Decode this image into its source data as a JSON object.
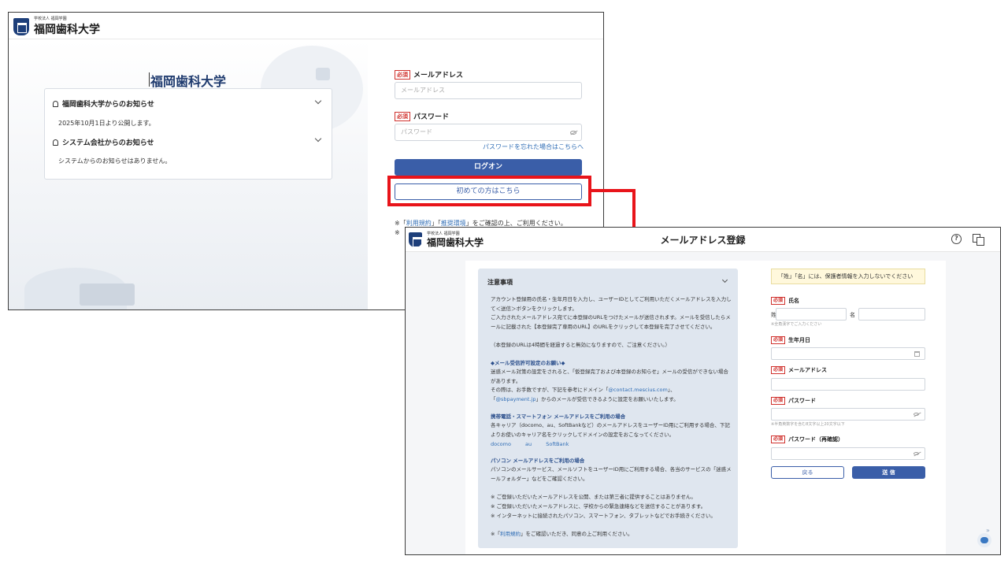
{
  "login": {
    "logo_sub": "学校法人 福岡学園",
    "logo_main": "福岡歯科大学",
    "center_title": "福岡歯科大学",
    "notices": [
      {
        "heading": "福岡歯科大学からのお知らせ",
        "body": "2025年10月1日より公開します。"
      },
      {
        "heading": "システム会社からのお知らせ",
        "body": "システムからのお知らせはありません。"
      }
    ],
    "required_badge": "必須",
    "email_label": "メールアドレス",
    "email_placeholder": "メールアドレス",
    "password_label": "パスワード",
    "password_placeholder": "パスワード",
    "forgot_password": "パスワードを忘れた場合はこちらへ",
    "logon_button": "ログオン",
    "first_time_button": "初めての方はこちら",
    "terms_prefix": "※「",
    "terms_link": "利用規約",
    "terms_mid": "」「",
    "env_link": "推奨環境",
    "terms_suffix": "」をご確認の上、ご利用ください。",
    "terms_note2": "※"
  },
  "register": {
    "logo_sub": "学校法人 福岡学園",
    "logo_main": "福岡歯科大学",
    "title": "メールアドレス登録",
    "help_icon": "?",
    "notice_heading": "注意事項",
    "p1": "アカウント登録用の氏名・生年月日を入力し、ユーザーIDとしてご利用いただくメールアドレスを入力して＜送信＞ボタンをクリックします。",
    "p2": "ご入力されたメールアドレス宛てに本登録のURLをつけたメールが送信されます。メールを受信したらメールに記載された【本登録完了専用のURL】のURLをクリックして本登録を完了させてください。",
    "p3": "（本登録のURLは4時間を経過すると無効になりますので、ご注意ください。）",
    "s1_title": "◆メール受信許可設定のお願い◆",
    "s1_text": "迷惑メール対策の設定をされると、「仮登録完了および本登録のお知らせ」メールの受信ができない場合があります。",
    "s1_text2_a": "その際は、お手数ですが、下記を参考にドメイン「",
    "s1_domain1": "@contact.mescius.com",
    "s1_text2_b": "」、",
    "s1_text3_a": "「",
    "s1_domain2": "@sbpayment.jp",
    "s1_text3_b": "」からのメールが受信できるように設定をお願いいたします。",
    "s2_title": "携帯電話・スマートフォン メールアドレスをご利用の場合",
    "s2_text": "各キャリア（docomo、au、SoftBankなど）のメールアドレスをユーザーID用にご利用する場合、下記よりお使いのキャリア名をクリックしてドメインの設定をおこなってください。",
    "carriers": [
      "docomo",
      "au",
      "SoftBank"
    ],
    "s3_title": "パソコン メールアドレスをご利用の場合",
    "s3_text": "パソコンのメールサービス、メールソフトをユーザーID用にご利用する場合、各当のサービスの「迷惑メールフォルダー」などをご確認ください。",
    "f1": "※ ご登録いただいたメールアドレスを公開、または第三者に提供することはありません。",
    "f2": "※ ご登録いただいたメールアドレスに、学校からの緊急連絡などを送信することがあります。",
    "f3": "※ インターネットに接続されたパソコン、スマートフォン、タブレットなどでお手続きください。",
    "f4_a": "※「",
    "f4_link": "利用規約",
    "f4_b": "」をご確認いただき、同意の上ご利用ください。",
    "warning": "「姓」「名」には、保護者情報を入力しないでください",
    "required_badge": "必須",
    "name_label": "氏名",
    "sei": "姓",
    "mei": "名",
    "name_hint": "※全角漢字でご入力ください",
    "birth_label": "生年月日",
    "email_label": "メールアドレス",
    "password_label": "パスワード",
    "password_hint": "※半角英数字を含む8文字以上20文字以下",
    "password_confirm_label": "パスワード（再確認）",
    "back_button": "戻る",
    "submit_button": "送 信"
  },
  "colors": {
    "primary": "#3a5ea8",
    "highlight": "#e8141a",
    "required": "#d0312d",
    "brand_navy": "#1e3f7a"
  }
}
